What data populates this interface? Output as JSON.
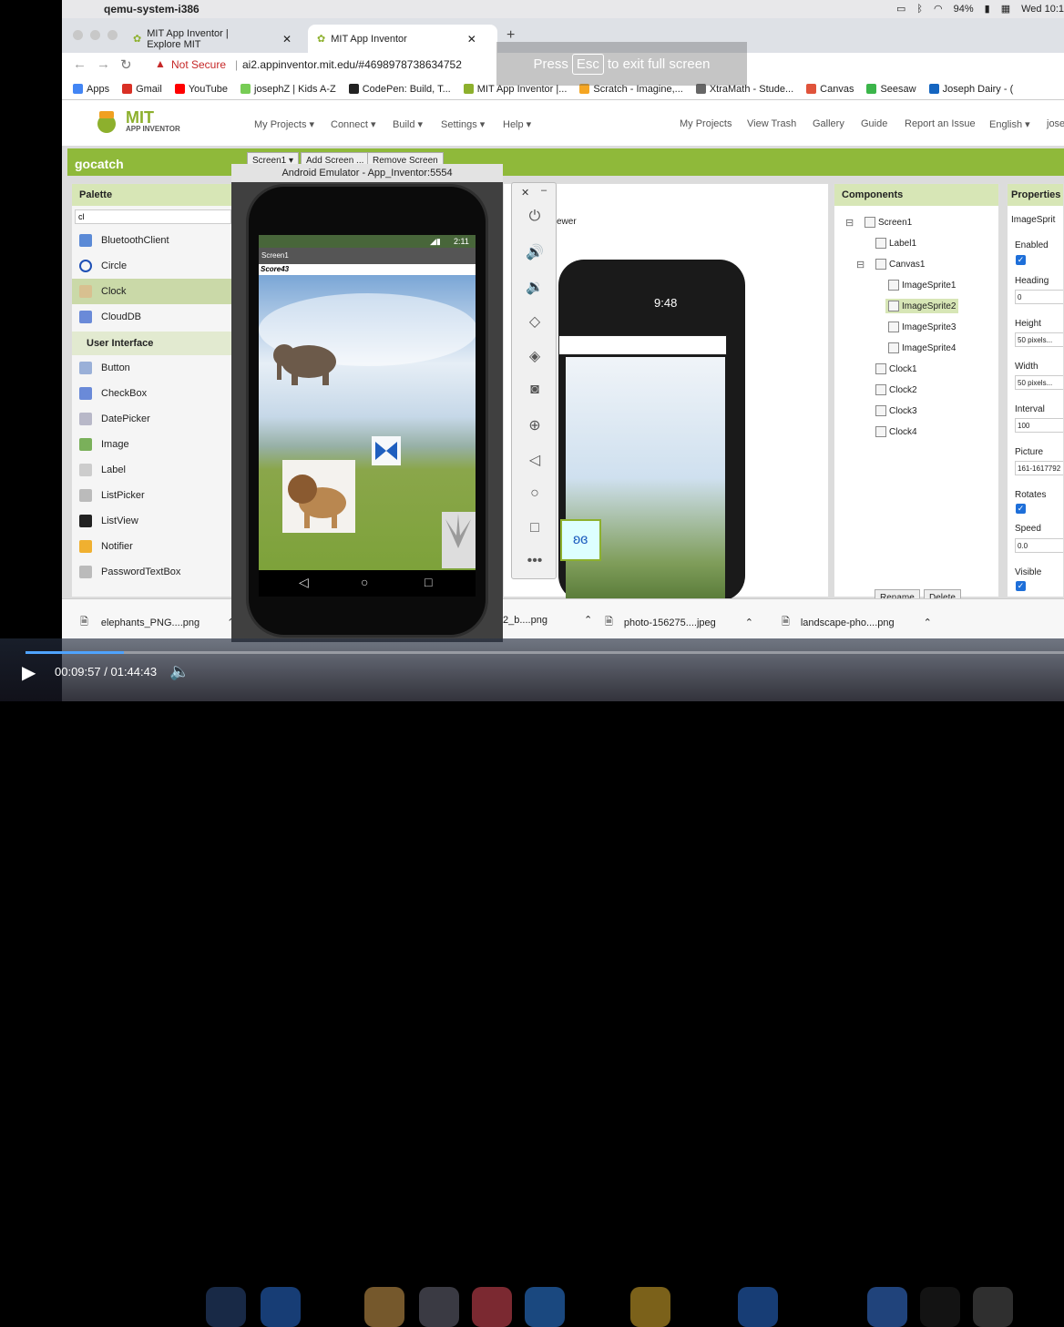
{
  "menubar": {
    "app_name": "qemu-system-i386",
    "battery": "94%",
    "clock": "Wed 10:1"
  },
  "tabs": [
    {
      "label": "MIT App Inventor | Explore MIT"
    },
    {
      "label": "MIT App Inventor"
    }
  ],
  "address": {
    "warning": "Not Secure",
    "url": "ai2.appinventor.mit.edu/#4698978738634752"
  },
  "fullscreen_note": {
    "press": "Press",
    "key": "Esc",
    "rest": "to exit full screen"
  },
  "bookmarks": [
    "Apps",
    "Gmail",
    "YouTube",
    "josephZ | Kids A-Z",
    "CodePen: Build, T...",
    "MIT App Inventor |...",
    "Scratch - Imagine,...",
    "XtraMath - Stude...",
    "Canvas",
    "Seesaw",
    "Joseph Dairy - ("
  ],
  "ai_header": {
    "logo_mit": "MIT",
    "logo_sub": "APP INVENTOR",
    "menus": [
      "My Projects ▾",
      "Connect ▾",
      "Build ▾",
      "Settings ▾",
      "Help ▾"
    ],
    "links": [
      "My Projects",
      "View Trash",
      "Gallery",
      "Guide",
      "Report an Issue",
      "English ▾",
      "jose"
    ]
  },
  "project": {
    "name": "gocatch",
    "screen_btn": "Screen1 ▾",
    "add_screen": "Add Screen ...",
    "remove_screen": "Remove Screen"
  },
  "palette": {
    "title": "Palette",
    "search_value": "cl",
    "results": [
      "BluetoothClient",
      "Circle",
      "Clock",
      "CloudDB"
    ],
    "section": "User Interface",
    "ui_items": [
      "Button",
      "CheckBox",
      "DatePicker",
      "Image",
      "Label",
      "ListPicker",
      "ListView",
      "Notifier",
      "PasswordTextBox"
    ]
  },
  "viewer": {
    "partial_text": "ewer",
    "time": "9:48"
  },
  "components": {
    "title": "Components",
    "tree": [
      "Screen1",
      "Label1",
      "Canvas1",
      "ImageSprite1",
      "ImageSprite2",
      "ImageSprite3",
      "ImageSprite4",
      "Clock1",
      "Clock2",
      "Clock3",
      "Clock4"
    ],
    "rename": "Rename",
    "delete": "Delete"
  },
  "properties": {
    "title": "Properties",
    "subject": "ImageSprit",
    "enabled_label": "Enabled",
    "heading_label": "Heading",
    "heading_value": "0",
    "height_label": "Height",
    "height_value": "50 pixels...",
    "width_label": "Width",
    "width_value": "50 pixels...",
    "interval_label": "Interval",
    "interval_value": "100",
    "picture_label": "Picture",
    "picture_value": "161-1617792",
    "rotates_label": "Rotates",
    "speed_label": "Speed",
    "speed_value": "0.0",
    "visible_label": "Visible"
  },
  "emulator": {
    "title": "Android Emulator - App_Inventor:5554",
    "time": "2:11",
    "screen_title": "Screen1",
    "score": "Score43"
  },
  "downloads": [
    "elephants_PNG....png",
    "2_b....png",
    "photo-156275....jpeg",
    "landscape-pho....png"
  ],
  "video": {
    "current": "00:09:57",
    "separator": "/",
    "total": "01:44:43",
    "progress": 0.095
  }
}
